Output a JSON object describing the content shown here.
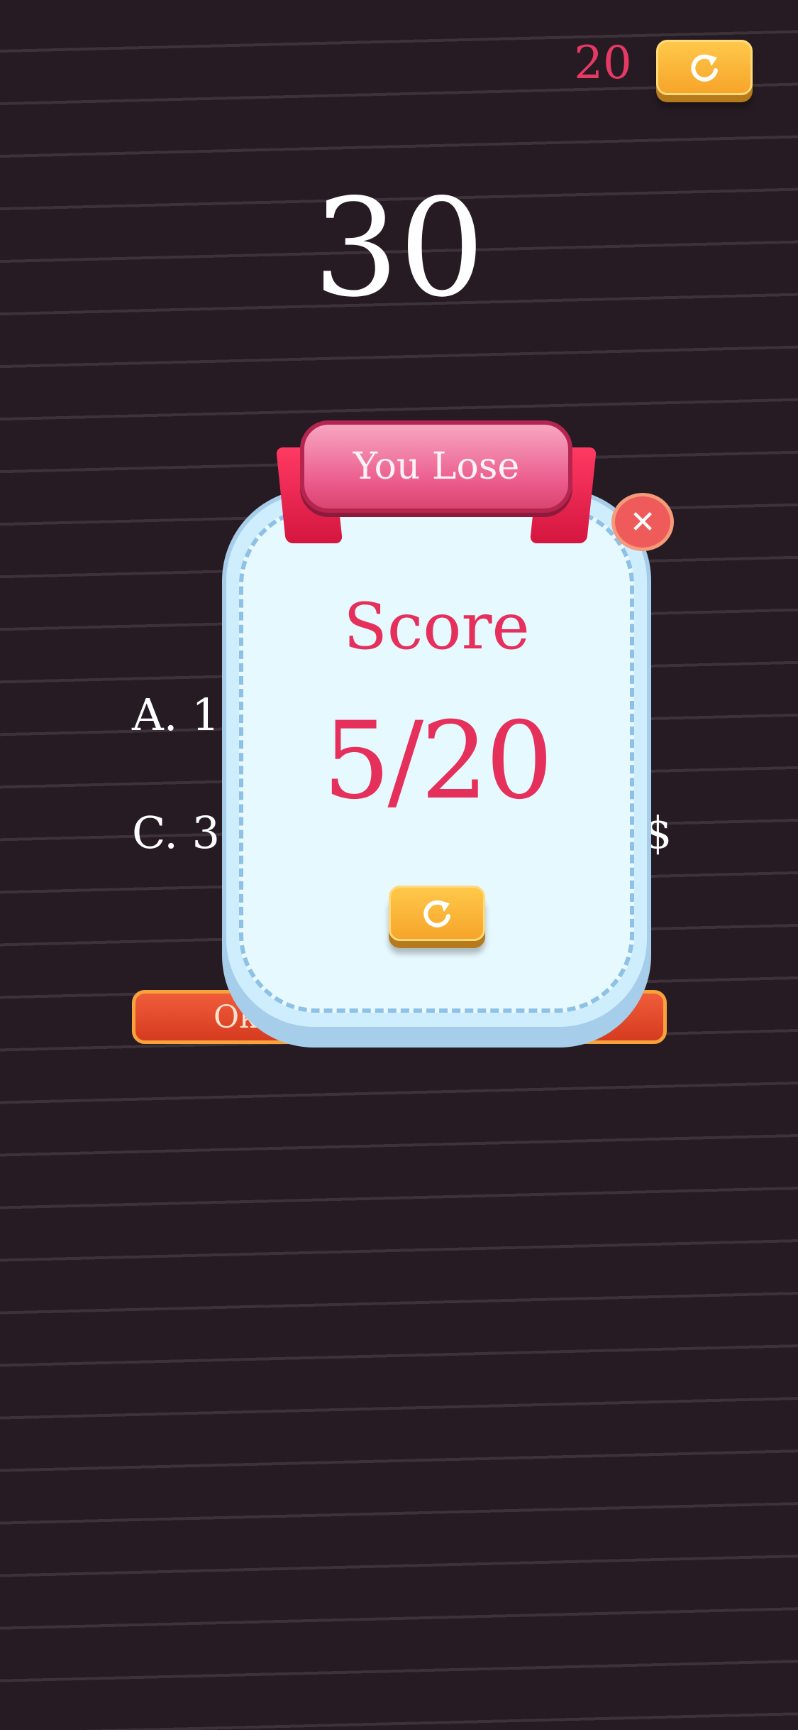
{
  "header": {
    "score": "20",
    "restart_icon": "restart-icon"
  },
  "timer": "30",
  "options": {
    "a": "A. 10",
    "c": "C. 30",
    "d_suffix": "$"
  },
  "answers": {
    "left_label": "Ok"
  },
  "modal": {
    "title": "You Lose",
    "score_label": "Score",
    "score_value": "5/20",
    "close_icon": "close-icon",
    "restart_icon": "restart-icon"
  },
  "colors": {
    "background": "#261b23",
    "accent_pink": "#e6305c",
    "button_orange": "#f6a52a",
    "panel_blue": "#e6f9fe"
  }
}
